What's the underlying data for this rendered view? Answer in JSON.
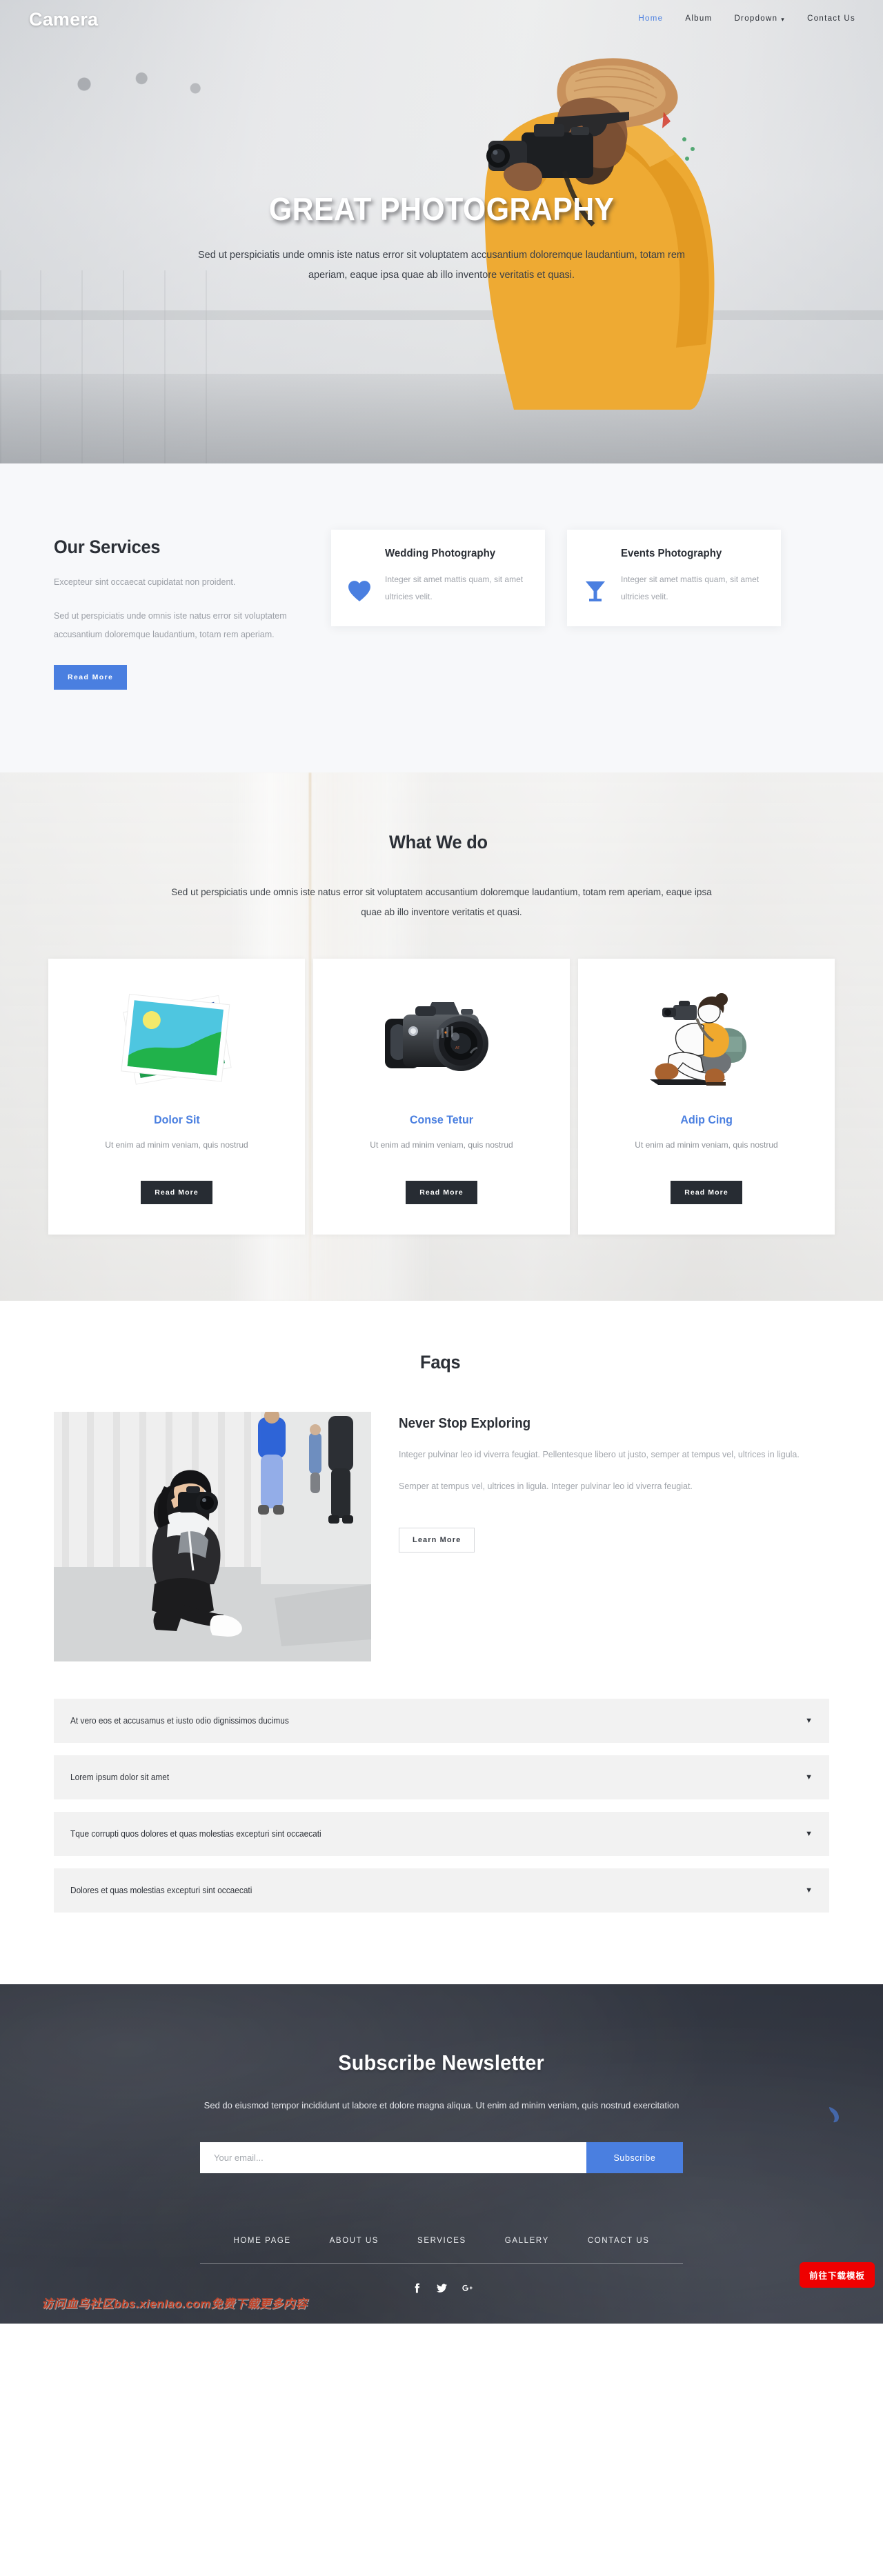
{
  "nav": {
    "brand": "Camera",
    "items": [
      {
        "label": "Home",
        "active": true
      },
      {
        "label": "Album",
        "active": false
      },
      {
        "label": "Dropdown",
        "active": false,
        "caret": "chevron-down"
      },
      {
        "label": "Contact Us",
        "active": false
      }
    ]
  },
  "hero": {
    "title": "GREAT PHOTOGRAPHY",
    "subtitle": "Sed ut perspiciatis unde omnis iste natus error sit voluptatem accusantium doloremque laudantium, totam rem aperiam, eaque ipsa quae ab illo inventore veritatis et quasi."
  },
  "services": {
    "heading": "Our Services",
    "paragraph1": "Excepteur sint occaecat cupidatat non proident.",
    "paragraph2": "Sed ut perspiciatis unde omnis iste natus error sit voluptatem accusantium doloremque laudantium, totam rem aperiam.",
    "read_more": "Read More",
    "cards": [
      {
        "icon": "heart-icon",
        "title": "Wedding Photography",
        "text": "Integer sit amet mattis quam, sit amet ultricies velit."
      },
      {
        "icon": "cocktail-glass-icon",
        "title": "Events Photography",
        "text": "Integer sit amet mattis quam, sit amet ultricies velit."
      }
    ]
  },
  "whatwedo": {
    "heading": "What We do",
    "subtitle": "Sed ut perspiciatis unde omnis iste natus error sit voluptatem accusantium doloremque laudantium, totam rem aperiam, eaque ipsa quae ab illo inventore veritatis et quasi.",
    "cards": [
      {
        "art": "photo-stack-icon",
        "title": "Dolor Sit",
        "text": "Ut enim ad minim veniam, quis nostrud",
        "button": "Read More"
      },
      {
        "art": "dslr-camera-icon",
        "title": "Conse Tetur",
        "text": "Ut enim ad minim veniam, quis nostrud",
        "button": "Read More"
      },
      {
        "art": "photographer-illustration-icon",
        "title": "Adip Cing",
        "text": "Ut enim ad minim veniam, quis nostrud",
        "button": "Read More"
      }
    ]
  },
  "faqs": {
    "heading": "Faqs",
    "side_title": "Never Stop Exploring",
    "side_p1": "Integer pulvinar leo id viverra feugiat. Pellentesque libero ut justo, semper at tempus vel, ultrices in ligula.",
    "side_p2": "Semper at tempus vel, ultrices in ligula. Integer pulvinar leo id viverra feugiat.",
    "learn_more": "Learn More",
    "items": [
      {
        "question": "At vero eos et accusamus et iusto odio dignissimos ducimus",
        "chevron": "▼"
      },
      {
        "question": "Lorem ipsum dolor sit amet",
        "chevron": "▼"
      },
      {
        "question": "Tque corrupti quos dolores et quas molestias excepturi sint occaecati",
        "chevron": "▼"
      },
      {
        "question": "Dolores et quas molestias excepturi sint occaecati",
        "chevron": "▼"
      }
    ]
  },
  "newsletter": {
    "heading": "Subscribe Newsletter",
    "text": "Sed do eiusmod tempor incididunt ut labore et dolore magna aliqua. Ut enim ad minim veniam, quis nostrud exercitation",
    "input_placeholder": "Your email...",
    "input_value": "",
    "button": "Subscribe"
  },
  "footer": {
    "links": [
      "HOME PAGE",
      "ABOUT US",
      "SERVICES",
      "GALLERY",
      "CONTACT US"
    ],
    "socials": [
      {
        "name": "facebook-icon",
        "glyph": "f"
      },
      {
        "name": "twitter-icon",
        "glyph": "t"
      },
      {
        "name": "google-plus-icon",
        "glyph": "G+"
      }
    ]
  },
  "overlay": {
    "watermark": "访问血鸟社区bbs.xienIao.com免费下载更多内容",
    "download_button": "前往下载模板"
  },
  "colors": {
    "accent_blue": "#4a7fe0",
    "dark": "#272c33",
    "muted_text": "#a0a4ab",
    "panel": "#f2f2f2",
    "download_red": "#ef0000"
  }
}
